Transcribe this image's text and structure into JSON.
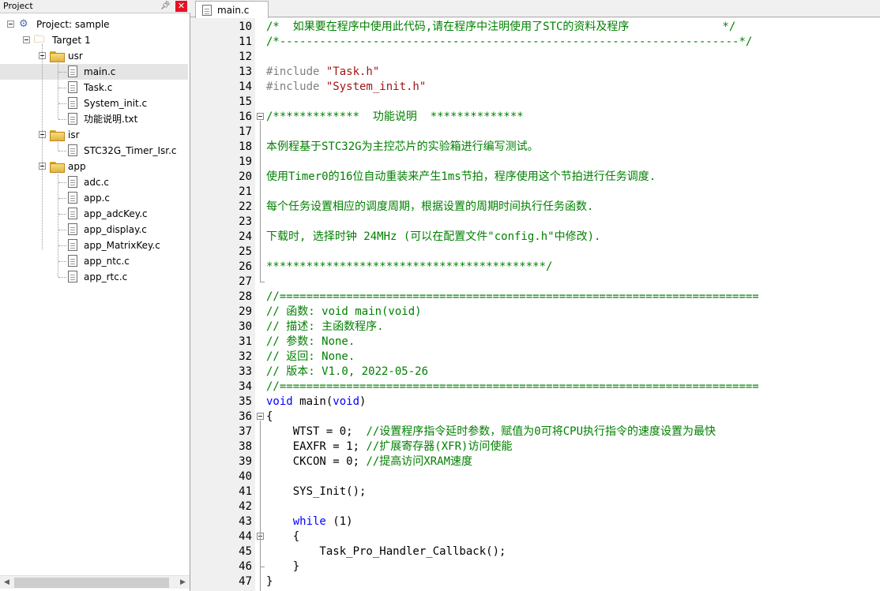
{
  "colors": {
    "comment": "#008000",
    "preprocessor": "#808080",
    "string": "#a31515",
    "keyword": "#0000ff",
    "close_button": "#e81123"
  },
  "project_panel": {
    "title": "Project",
    "pin_icon": "pin-icon",
    "close_icon": "close-icon",
    "project_label": "Project: sample",
    "target_label": "Target 1",
    "groups": [
      {
        "name": "usr",
        "files": [
          "main.c",
          "Task.c",
          "System_init.c",
          "功能说明.txt"
        ]
      },
      {
        "name": "isr",
        "files": [
          "STC32G_Timer_Isr.c"
        ]
      },
      {
        "name": "app",
        "files": [
          "adc.c",
          "app.c",
          "app_adcKey.c",
          "app_display.c",
          "app_MatrixKey.c",
          "app_ntc.c",
          "app_rtc.c"
        ]
      }
    ],
    "selected_file": "main.c"
  },
  "editor": {
    "active_tab": "main.c",
    "lines": [
      {
        "n": "10",
        "parts": [
          {
            "t": "/*  如果要在程序中使用此代码,请在程序中注明使用了STC的资料及程序              */",
            "c": "comment"
          }
        ]
      },
      {
        "n": "11",
        "parts": [
          {
            "t": "/*---------------------------------------------------------------------*/",
            "c": "comment"
          }
        ]
      },
      {
        "n": "12",
        "parts": []
      },
      {
        "n": "13",
        "parts": [
          {
            "t": "#include ",
            "c": "pre"
          },
          {
            "t": "\"Task.h\"",
            "c": "str"
          }
        ]
      },
      {
        "n": "14",
        "parts": [
          {
            "t": "#include ",
            "c": "pre"
          },
          {
            "t": "\"System_init.h\"",
            "c": "str"
          }
        ]
      },
      {
        "n": "15",
        "parts": []
      },
      {
        "n": "16",
        "fold": "start",
        "parts": [
          {
            "t": "/*************  功能说明  **************",
            "c": "comment"
          }
        ]
      },
      {
        "n": "17",
        "parts": []
      },
      {
        "n": "18",
        "parts": [
          {
            "t": "本例程基于STC32G为主控芯片的实验箱进行编写测试。",
            "c": "comment"
          }
        ]
      },
      {
        "n": "19",
        "parts": []
      },
      {
        "n": "20",
        "parts": [
          {
            "t": "使用Timer0的16位自动重装来产生1ms节拍，程序使用这个节拍进行任务调度.",
            "c": "comment"
          }
        ]
      },
      {
        "n": "21",
        "parts": []
      },
      {
        "n": "22",
        "parts": [
          {
            "t": "每个任务设置相应的调度周期，根据设置的周期时间执行任务函数.",
            "c": "comment"
          }
        ]
      },
      {
        "n": "23",
        "parts": []
      },
      {
        "n": "24",
        "parts": [
          {
            "t": "下载时, 选择时钟 24MHz (可以在配置文件\"config.h\"中修改).",
            "c": "comment"
          }
        ]
      },
      {
        "n": "25",
        "parts": []
      },
      {
        "n": "26",
        "parts": [
          {
            "t": "******************************************/",
            "c": "comment"
          }
        ]
      },
      {
        "n": "27",
        "fold": "end",
        "parts": []
      },
      {
        "n": "28",
        "parts": [
          {
            "t": "//========================================================================",
            "c": "comment"
          }
        ]
      },
      {
        "n": "29",
        "parts": [
          {
            "t": "// 函数: void main(void)",
            "c": "comment"
          }
        ]
      },
      {
        "n": "30",
        "parts": [
          {
            "t": "// 描述: 主函数程序.",
            "c": "comment"
          }
        ]
      },
      {
        "n": "31",
        "parts": [
          {
            "t": "// 参数: None.",
            "c": "comment"
          }
        ]
      },
      {
        "n": "32",
        "parts": [
          {
            "t": "// 返回: None.",
            "c": "comment"
          }
        ]
      },
      {
        "n": "33",
        "parts": [
          {
            "t": "// 版本: V1.0, 2022-05-26",
            "c": "comment"
          }
        ]
      },
      {
        "n": "34",
        "parts": [
          {
            "t": "//========================================================================",
            "c": "comment"
          }
        ]
      },
      {
        "n": "35",
        "parts": [
          {
            "t": "void",
            "c": "kw"
          },
          {
            "t": " main(",
            "c": "plain"
          },
          {
            "t": "void",
            "c": "kw"
          },
          {
            "t": ")",
            "c": "plain"
          }
        ]
      },
      {
        "n": "36",
        "fold": "start",
        "parts": [
          {
            "t": "{",
            "c": "plain"
          }
        ]
      },
      {
        "n": "37",
        "parts": [
          {
            "t": "    WTST = 0;  ",
            "c": "plain"
          },
          {
            "t": "//设置程序指令延时参数，赋值为0可将CPU执行指令的速度设置为最快",
            "c": "comment"
          }
        ]
      },
      {
        "n": "38",
        "parts": [
          {
            "t": "    EAXFR = 1; ",
            "c": "plain"
          },
          {
            "t": "//扩展寄存器(XFR)访问使能",
            "c": "comment"
          }
        ]
      },
      {
        "n": "39",
        "parts": [
          {
            "t": "    CKCON = 0; ",
            "c": "plain"
          },
          {
            "t": "//提高访问XRAM速度",
            "c": "comment"
          }
        ]
      },
      {
        "n": "40",
        "parts": []
      },
      {
        "n": "41",
        "parts": [
          {
            "t": "    SYS_Init();",
            "c": "plain"
          }
        ]
      },
      {
        "n": "42",
        "parts": []
      },
      {
        "n": "43",
        "parts": [
          {
            "t": "    ",
            "c": "plain"
          },
          {
            "t": "while",
            "c": "kw"
          },
          {
            "t": " (1)",
            "c": "plain"
          }
        ]
      },
      {
        "n": "44",
        "fold": "start",
        "parts": [
          {
            "t": "    {",
            "c": "plain"
          }
        ]
      },
      {
        "n": "45",
        "parts": [
          {
            "t": "        Task_Pro_Handler_Callback();",
            "c": "plain"
          }
        ]
      },
      {
        "n": "46",
        "fold": "end",
        "parts": [
          {
            "t": "    }",
            "c": "plain"
          }
        ]
      },
      {
        "n": "47",
        "parts": [
          {
            "t": "}",
            "c": "plain"
          }
        ]
      }
    ]
  }
}
